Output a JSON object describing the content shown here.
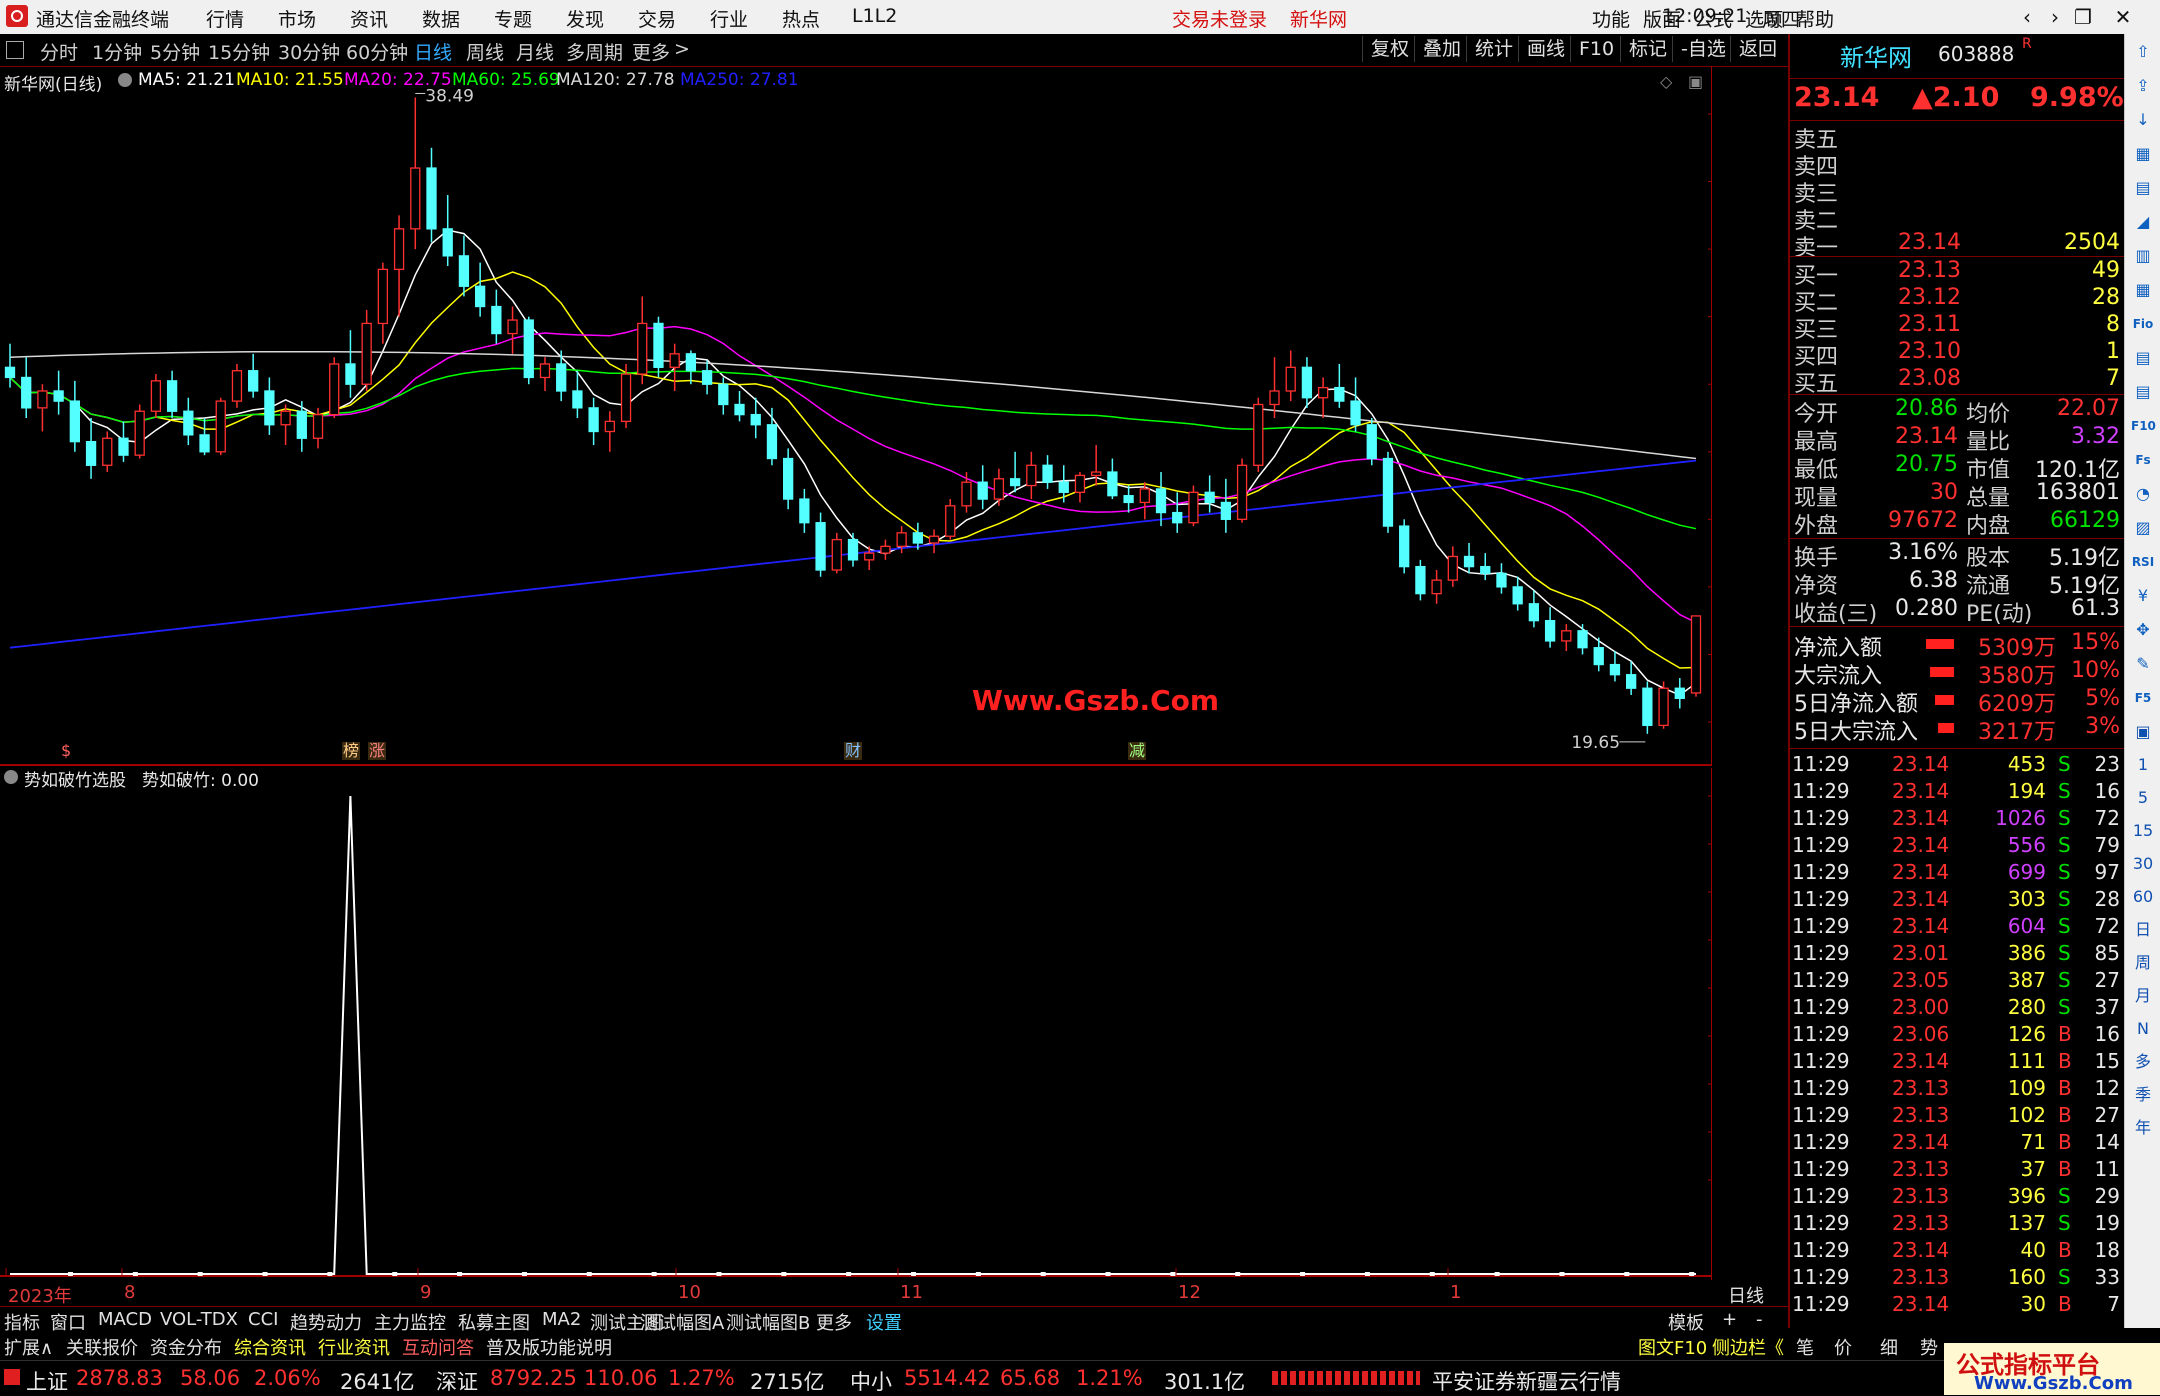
{
  "app": {
    "title": "通达信金融终端",
    "menus": [
      "行情",
      "市场",
      "资讯",
      "数据",
      "专题",
      "发现",
      "交易",
      "行业",
      "热点",
      "L1L2"
    ],
    "status_notice": "交易未登录",
    "stock_tab": "新华网",
    "right_menus": [
      "功能",
      "版面",
      "公式",
      "选项",
      "帮助"
    ],
    "time": "12:09:21",
    "weekday": "周四"
  },
  "period_bar": {
    "items": [
      "分时",
      "1分钟",
      "5分钟",
      "15分钟",
      "30分钟",
      "60分钟",
      "日线",
      "周线",
      "月线",
      "多周期",
      "更多"
    ],
    "active": "日线",
    "more_arrow": ">",
    "right_buttons": [
      "复权",
      "叠加",
      "统计",
      "画线",
      "F10",
      "标记",
      "-自选",
      "返回"
    ]
  },
  "ma_legend": {
    "stock": "新华网(日线)",
    "items": [
      {
        "label": "MA5: 21.21",
        "color": "#ffffff"
      },
      {
        "label": "MA10: 21.55",
        "color": "#ffff00"
      },
      {
        "label": "MA20: 22.75",
        "color": "#ff00ff"
      },
      {
        "label": "MA60: 25.69",
        "color": "#00ff00"
      },
      {
        "label": "MA120: 27.78",
        "color": "#d8d8d8"
      },
      {
        "label": "MA250: 27.81",
        "color": "#2020ff"
      }
    ]
  },
  "main_chart": {
    "y_ticks": [
      "38.00",
      "36.00",
      "34.00",
      "32.00",
      "30.00",
      "28.00",
      "26.00",
      "24.00",
      "22.00",
      "20.00"
    ],
    "high_label": "38.49",
    "low_label": "19.65",
    "watermark": "Www.Gszb.Com",
    "event_marks": [
      "$",
      "榜",
      "涨",
      "财",
      "减"
    ]
  },
  "indicator": {
    "title": "势如破竹选股",
    "value_label": "势如破竹: 0.00",
    "y_ticks": [
      "1.00",
      "0.90",
      "0.80",
      "0.70",
      "0.60",
      "0.50",
      "0.40",
      "0.30",
      "0.20"
    ],
    "x_labels": [
      "2023年",
      "8",
      "9",
      "10",
      "11",
      "12",
      "1"
    ],
    "axis_caption": "日线"
  },
  "quote": {
    "name": "新华网",
    "code": "603888",
    "tag": "R",
    "price": "23.14",
    "change": "▲2.10",
    "pct": "9.98%",
    "asks": [
      {
        "label": "卖五",
        "price": "",
        "vol": ""
      },
      {
        "label": "卖四",
        "price": "",
        "vol": ""
      },
      {
        "label": "卖三",
        "price": "",
        "vol": ""
      },
      {
        "label": "卖二",
        "price": "",
        "vol": ""
      },
      {
        "label": "卖一",
        "price": "23.14",
        "vol": "2504"
      }
    ],
    "bids": [
      {
        "label": "买一",
        "price": "23.13",
        "vol": "49"
      },
      {
        "label": "买二",
        "price": "23.12",
        "vol": "28"
      },
      {
        "label": "买三",
        "price": "23.11",
        "vol": "8"
      },
      {
        "label": "买四",
        "price": "23.10",
        "vol": "1"
      },
      {
        "label": "买五",
        "price": "23.08",
        "vol": "7"
      }
    ],
    "stats": [
      {
        "l1": "今开",
        "v1": "20.86",
        "c1": "grn",
        "l2": "均价",
        "v2": "22.07",
        "c2": "red"
      },
      {
        "l1": "最高",
        "v1": "23.14",
        "c1": "red",
        "l2": "量比",
        "v2": "3.32",
        "c2": "pur"
      },
      {
        "l1": "最低",
        "v1": "20.75",
        "c1": "grn",
        "l2": "市值",
        "v2": "120.1亿",
        "c2": "wht"
      },
      {
        "l1": "现量",
        "v1": "30",
        "c1": "red",
        "l2": "总量",
        "v2": "163801",
        "c2": "wht"
      },
      {
        "l1": "外盘",
        "v1": "97672",
        "c1": "red",
        "l2": "内盘",
        "v2": "66129",
        "c2": "grn"
      }
    ],
    "stats2": [
      {
        "l1": "换手",
        "v1": "3.16%",
        "l2": "股本",
        "v2": "5.19亿"
      },
      {
        "l1": "净资",
        "v1": "6.38",
        "l2": "流通",
        "v2": "5.19亿"
      },
      {
        "l1": "收益(三)",
        "v1": "0.280",
        "l2": "PE(动)",
        "v2": "61.3"
      }
    ],
    "flows": [
      {
        "label": "净流入额",
        "value": "5309万",
        "pct": "15%",
        "bar": 0.6
      },
      {
        "label": "大宗流入",
        "value": "3580万",
        "pct": "10%",
        "bar": 0.45
      },
      {
        "label": "5日净流入额",
        "value": "6209万",
        "pct": "5%",
        "bar": 0.3
      },
      {
        "label": "5日大宗流入",
        "value": "3217万",
        "pct": "3%",
        "bar": 0.2
      }
    ]
  },
  "ticks": [
    {
      "t": "11:29",
      "p": "23.14",
      "v": "453",
      "s": "S",
      "n": "23",
      "pc": "red",
      "vc": "yel"
    },
    {
      "t": "11:29",
      "p": "23.14",
      "v": "194",
      "s": "S",
      "n": "16",
      "pc": "red",
      "vc": "yel"
    },
    {
      "t": "11:29",
      "p": "23.14",
      "v": "1026",
      "s": "S",
      "n": "72",
      "pc": "red",
      "vc": "pur"
    },
    {
      "t": "11:29",
      "p": "23.14",
      "v": "556",
      "s": "S",
      "n": "79",
      "pc": "red",
      "vc": "pur"
    },
    {
      "t": "11:29",
      "p": "23.14",
      "v": "699",
      "s": "S",
      "n": "97",
      "pc": "red",
      "vc": "pur"
    },
    {
      "t": "11:29",
      "p": "23.14",
      "v": "303",
      "s": "S",
      "n": "28",
      "pc": "red",
      "vc": "yel"
    },
    {
      "t": "11:29",
      "p": "23.14",
      "v": "604",
      "s": "S",
      "n": "72",
      "pc": "red",
      "vc": "pur"
    },
    {
      "t": "11:29",
      "p": "23.01",
      "v": "386",
      "s": "S",
      "n": "85",
      "pc": "red",
      "vc": "yel"
    },
    {
      "t": "11:29",
      "p": "23.05",
      "v": "387",
      "s": "S",
      "n": "27",
      "pc": "red",
      "vc": "yel"
    },
    {
      "t": "11:29",
      "p": "23.00",
      "v": "280",
      "s": "S",
      "n": "37",
      "pc": "red",
      "vc": "yel"
    },
    {
      "t": "11:29",
      "p": "23.06",
      "v": "126",
      "s": "B",
      "n": "16",
      "pc": "red",
      "vc": "yel"
    },
    {
      "t": "11:29",
      "p": "23.14",
      "v": "111",
      "s": "B",
      "n": "15",
      "pc": "red",
      "vc": "yel"
    },
    {
      "t": "11:29",
      "p": "23.13",
      "v": "109",
      "s": "B",
      "n": "12",
      "pc": "red",
      "vc": "yel"
    },
    {
      "t": "11:29",
      "p": "23.13",
      "v": "102",
      "s": "B",
      "n": "27",
      "pc": "red",
      "vc": "yel"
    },
    {
      "t": "11:29",
      "p": "23.14",
      "v": "71",
      "s": "B",
      "n": "14",
      "pc": "red",
      "vc": "yel"
    },
    {
      "t": "11:29",
      "p": "23.13",
      "v": "37",
      "s": "B",
      "n": "11",
      "pc": "red",
      "vc": "yel"
    },
    {
      "t": "11:29",
      "p": "23.13",
      "v": "396",
      "s": "S",
      "n": "29",
      "pc": "red",
      "vc": "yel"
    },
    {
      "t": "11:29",
      "p": "23.13",
      "v": "137",
      "s": "S",
      "n": "19",
      "pc": "red",
      "vc": "yel"
    },
    {
      "t": "11:29",
      "p": "23.14",
      "v": "40",
      "s": "B",
      "n": "18",
      "pc": "red",
      "vc": "yel"
    },
    {
      "t": "11:29",
      "p": "23.13",
      "v": "160",
      "s": "S",
      "n": "33",
      "pc": "red",
      "vc": "yel"
    },
    {
      "t": "11:29",
      "p": "23.14",
      "v": "30",
      "s": "B",
      "n": "7",
      "pc": "red",
      "vc": "yel"
    }
  ],
  "tabs1": [
    "指标",
    "窗口",
    "MACD",
    "VOL-TDX",
    "CCI",
    "趋势动力",
    "主力监控",
    "私募主图",
    "MA2",
    "测试主图",
    "测试幅图A",
    "测试幅图B",
    "更多",
    "设置"
  ],
  "tabs1_right": [
    "模板",
    "+",
    "-"
  ],
  "tabs2": [
    "扩展∧",
    "关联报价",
    "资金分布",
    "综合资讯",
    "行业资讯",
    "互动问答",
    "普及版功能说明"
  ],
  "tabs2_right": [
    "图文F10",
    "侧边栏《",
    "笔",
    "价",
    "细",
    "势"
  ],
  "status": {
    "sh_label": "上证",
    "sh_val": "2878.83",
    "sh_chg": "58.06",
    "sh_pct": "2.06%",
    "sh_amt": "2641亿",
    "sz_label": "深证",
    "sz_val": "8792.25",
    "sz_chg": "110.06",
    "sz_pct": "1.27%",
    "sz_amt": "2715亿",
    "zx_label": "中小",
    "zx_val": "5514.42",
    "zx_chg": "65.68",
    "zx_pct": "1.21%",
    "zx_amt": "301.1亿",
    "broker": "平安证券新疆云行情",
    "watermark": "公式指标平台",
    "watermark_url": "Www.Gszb.Com"
  },
  "iconbar": [
    "⇧",
    "⇪",
    "↓",
    "▦",
    "▤",
    "◢",
    "▥",
    "▦",
    "Fio",
    "▤",
    "▤",
    "F10",
    "Fs",
    "◔",
    "▨",
    "RSI",
    "¥",
    "✥",
    "✎",
    "F5",
    "▣",
    "1",
    "5",
    "15",
    "30",
    "60",
    "日",
    "周",
    "月",
    "N",
    "多",
    "季",
    "年"
  ]
}
